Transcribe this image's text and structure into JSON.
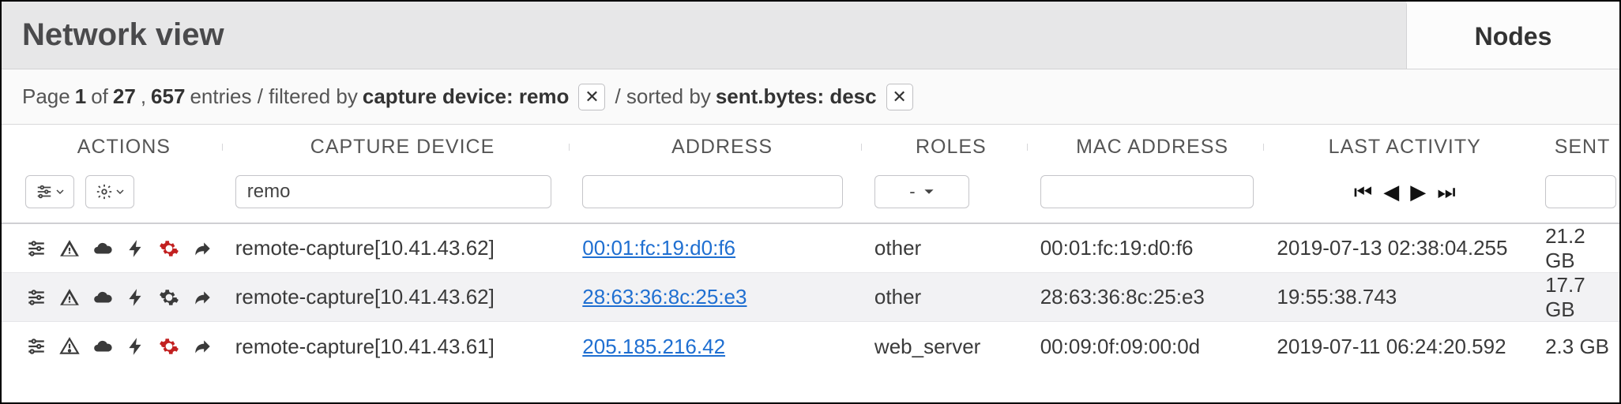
{
  "header": {
    "title": "Network view",
    "active_tab": "Nodes"
  },
  "filterbar": {
    "page_label_prefix": "Page ",
    "page_num": "1",
    "page_of": " of ",
    "page_total": "27",
    "sep1": ", ",
    "entries": "657",
    "entries_suffix": " entries / filtered by ",
    "filter_field": "capture device: remo",
    "sorted_prefix": " / sorted by ",
    "sort_field": "sent.bytes: desc"
  },
  "columns": {
    "actions": "ACTIONS",
    "capture": "CAPTURE DEVICE",
    "address": "ADDRESS",
    "roles": "ROLES",
    "mac": "MAC ADDRESS",
    "last": "LAST ACTIVITY",
    "sent": "SENT"
  },
  "controls": {
    "capture_value": "remo",
    "address_value": "",
    "roles_selected": "-",
    "mac_value": "",
    "sent_value": ""
  },
  "rows": [
    {
      "gear_red": true,
      "capture": "remote-capture[10.41.43.62]",
      "address": "00:01:fc:19:d0:f6",
      "roles": "other",
      "mac": "00:01:fc:19:d0:f6",
      "last": "2019-07-13 02:38:04.255",
      "sent": "21.2 GB"
    },
    {
      "gear_red": false,
      "capture": "remote-capture[10.41.43.62]",
      "address": "28:63:36:8c:25:e3",
      "roles": "other",
      "mac": "28:63:36:8c:25:e3",
      "last": "19:55:38.743",
      "sent": "17.7 GB"
    },
    {
      "gear_red": true,
      "capture": "remote-capture[10.41.43.61]",
      "address": "205.185.216.42",
      "roles": "web_server",
      "mac": "00:09:0f:09:00:0d",
      "last": "2019-07-11 06:24:20.592",
      "sent": "2.3 GB"
    }
  ]
}
